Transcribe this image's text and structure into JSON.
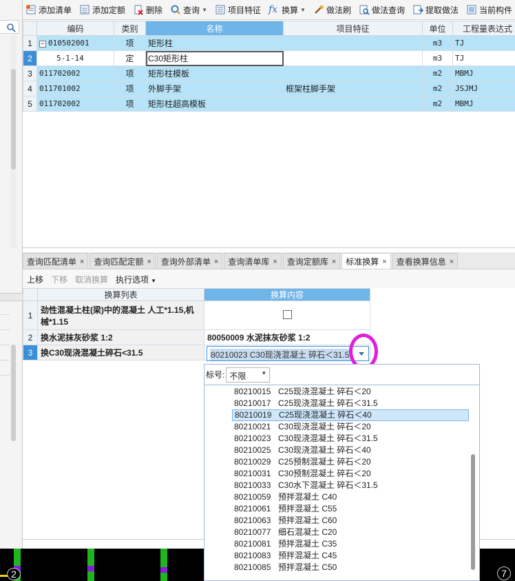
{
  "toolbar": {
    "buttons": [
      {
        "label": "添加清单"
      },
      {
        "label": "添加定额"
      },
      {
        "label": "删除"
      },
      {
        "label": "查询",
        "dropdown": true
      },
      {
        "label": "项目特征"
      },
      {
        "label": "换算",
        "dropdown": true
      },
      {
        "label": "做法刷"
      },
      {
        "label": "做法查询"
      },
      {
        "label": "提取做法"
      },
      {
        "label": "当前构件"
      }
    ],
    "fx_symbol": "fx"
  },
  "top_grid": {
    "headers": [
      "编码",
      "类别",
      "名称",
      "项目特征",
      "单位",
      "工程量表达式"
    ],
    "rows": [
      {
        "num": "1",
        "code": "010502001",
        "type": "项",
        "name": "矩形柱",
        "feature": "",
        "unit": "m3",
        "expr": "TJ",
        "toggle": "−"
      },
      {
        "num": "2",
        "code": "5-1-14",
        "type": "定",
        "name": "C30矩形柱",
        "feature": "",
        "unit": "m3",
        "expr": "TJ"
      },
      {
        "num": "3",
        "code": "011702002",
        "type": "项",
        "name": "矩形柱模板",
        "feature": "",
        "unit": "m2",
        "expr": "MBMJ"
      },
      {
        "num": "4",
        "code": "011701002",
        "type": "项",
        "name": "外脚手架",
        "feature": "框架柱脚手架",
        "unit": "m2",
        "expr": "JSJMJ"
      },
      {
        "num": "5",
        "code": "011702002",
        "type": "项",
        "name": "矩形柱超高模板",
        "feature": "",
        "unit": "m2",
        "expr": "MBMJ"
      }
    ]
  },
  "tabs": [
    {
      "label": "查询匹配清单",
      "close": "×"
    },
    {
      "label": "查询匹配定额",
      "close": "×"
    },
    {
      "label": "查询外部清单",
      "close": "×"
    },
    {
      "label": "查询清单库",
      "close": "×"
    },
    {
      "label": "查询定额库",
      "close": "×"
    },
    {
      "label": "标准换算",
      "close": "×",
      "active": true
    },
    {
      "label": "查看换算信息",
      "close": "×"
    }
  ],
  "subbar": {
    "up": "上移",
    "down": "下移",
    "cancel": "取消换算",
    "options": "执行选项"
  },
  "bottom_grid": {
    "headers": [
      "换算列表",
      "换算内容"
    ],
    "rows": [
      {
        "num": "1",
        "name": "劲性混凝土柱(梁)中的混凝土 人工*1.15,机械*1.15",
        "content": ""
      },
      {
        "num": "2",
        "name": "换水泥抹灰砂浆 1:2",
        "content": "80050009  水泥抹灰砂浆 1:2"
      },
      {
        "num": "3",
        "name": "换C30现浇混凝土碎石<31.5",
        "content": "80210023  C30现浇混凝土 碎石＜31.5"
      }
    ]
  },
  "dropdown": {
    "filter_label": "标号:",
    "filter_value": "不限",
    "items": [
      {
        "code": "80210015",
        "name": "C25现浇混凝土 碎石＜20"
      },
      {
        "code": "80210017",
        "name": "C25现浇混凝土 碎石＜31.5"
      },
      {
        "code": "80210019",
        "name": "C25现浇混凝土 碎石＜40",
        "selected": true
      },
      {
        "code": "80210021",
        "name": "C30现浇混凝土 碎石＜20"
      },
      {
        "code": "80210023",
        "name": "C30现浇混凝土 碎石＜31.5"
      },
      {
        "code": "80210025",
        "name": "C30现浇混凝土 碎石＜40"
      },
      {
        "code": "80210029",
        "name": "C25预制混凝土 碎石＜20"
      },
      {
        "code": "80210031",
        "name": "C30预制混凝土 碎石＜20"
      },
      {
        "code": "80210033",
        "name": "C30水下混凝土 碎石＜31.5"
      },
      {
        "code": "80210059",
        "name": "预拌混凝土 C40"
      },
      {
        "code": "80210061",
        "name": "预拌混凝土 C55"
      },
      {
        "code": "80210063",
        "name": "预拌混凝土 C60"
      },
      {
        "code": "80210077",
        "name": "细石混凝土 C20"
      },
      {
        "code": "80210081",
        "name": "预拌混凝土 C35"
      },
      {
        "code": "80210083",
        "name": "预拌混凝土 C45"
      },
      {
        "code": "80210085",
        "name": "预拌混凝土 C50"
      }
    ]
  },
  "bottom_strip": {
    "left_badge": "2",
    "right_badge": "7"
  },
  "colors": {
    "header_selected": "#6fb5e8",
    "row_highlight": "#b6e3f8",
    "current_row": "#3b8fd6",
    "annotation": "#e020d8"
  }
}
